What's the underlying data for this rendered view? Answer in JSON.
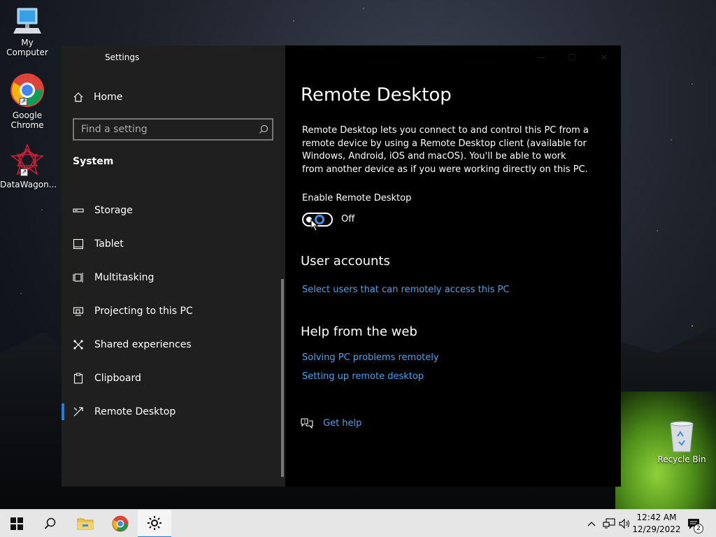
{
  "desktop": {
    "icons": [
      {
        "label": "My Computer"
      },
      {
        "label": "Google Chrome"
      },
      {
        "label": "DataWagon..."
      },
      {
        "label": "Recycle Bin"
      }
    ]
  },
  "window": {
    "title": "Settings",
    "sidebar": {
      "home_label": "Home",
      "search_placeholder": "Find a setting",
      "section_label": "System",
      "items": [
        {
          "label": "Storage",
          "icon": "storage-icon"
        },
        {
          "label": "Tablet",
          "icon": "tablet-icon"
        },
        {
          "label": "Multitasking",
          "icon": "multitasking-icon"
        },
        {
          "label": "Projecting to this PC",
          "icon": "projecting-icon"
        },
        {
          "label": "Shared experiences",
          "icon": "shared-experiences-icon"
        },
        {
          "label": "Clipboard",
          "icon": "clipboard-icon"
        },
        {
          "label": "Remote Desktop",
          "icon": "remote-desktop-icon",
          "active": true
        }
      ]
    },
    "main": {
      "title": "Remote Desktop",
      "description": "Remote Desktop lets you connect to and control this PC from a remote device by using a Remote Desktop client (available for Windows, Android, iOS and macOS). You'll be able to work from another device as if you were working directly on this PC.",
      "toggle_label": "Enable Remote Desktop",
      "toggle_state": "Off",
      "user_accounts_heading": "User accounts",
      "user_accounts_link": "Select users that can remotely access this PC",
      "help_heading": "Help from the web",
      "help_links": [
        "Solving PC problems remotely",
        "Setting up remote desktop"
      ],
      "get_help": "Get help"
    }
  },
  "taskbar": {
    "time": "12:42 AM",
    "date": "12/29/2022",
    "notification_count": "2"
  },
  "colors": {
    "accent": "#1a7fe0",
    "link": "#4aa0ec",
    "sidebar_bg": "#1f1f1f",
    "main_bg": "#000000"
  }
}
